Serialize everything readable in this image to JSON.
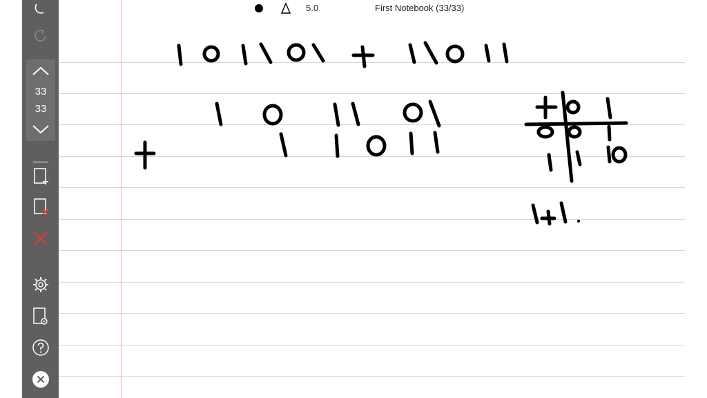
{
  "topbar": {
    "pen_size": "5.0",
    "notebook_title": "First Notebook (33/33)"
  },
  "page_nav": {
    "current": "33",
    "total": "33"
  },
  "toolbar": {
    "buttons": [
      "undo",
      "redo",
      "page-up",
      "page-down",
      "add-page",
      "delete-page",
      "delete",
      "settings",
      "page-settings",
      "help",
      "close"
    ]
  },
  "handwriting": {
    "problem": "101101 + 11011",
    "row1": "1 0 1 1 0 1",
    "row2": "1 1 0 1 1",
    "operator": "+",
    "table_header": [
      "+",
      "0",
      "1"
    ],
    "table_row0": [
      "0",
      "0",
      "1"
    ],
    "table_row1": [
      "1",
      "1",
      "10"
    ],
    "note": "1+1."
  },
  "colors": {
    "toolbar": "#5f5f5f",
    "margin_line": "#f1a6c7",
    "rule_line": "#d6d6d6",
    "delete_red": "#e53935",
    "ink": "#000000"
  }
}
